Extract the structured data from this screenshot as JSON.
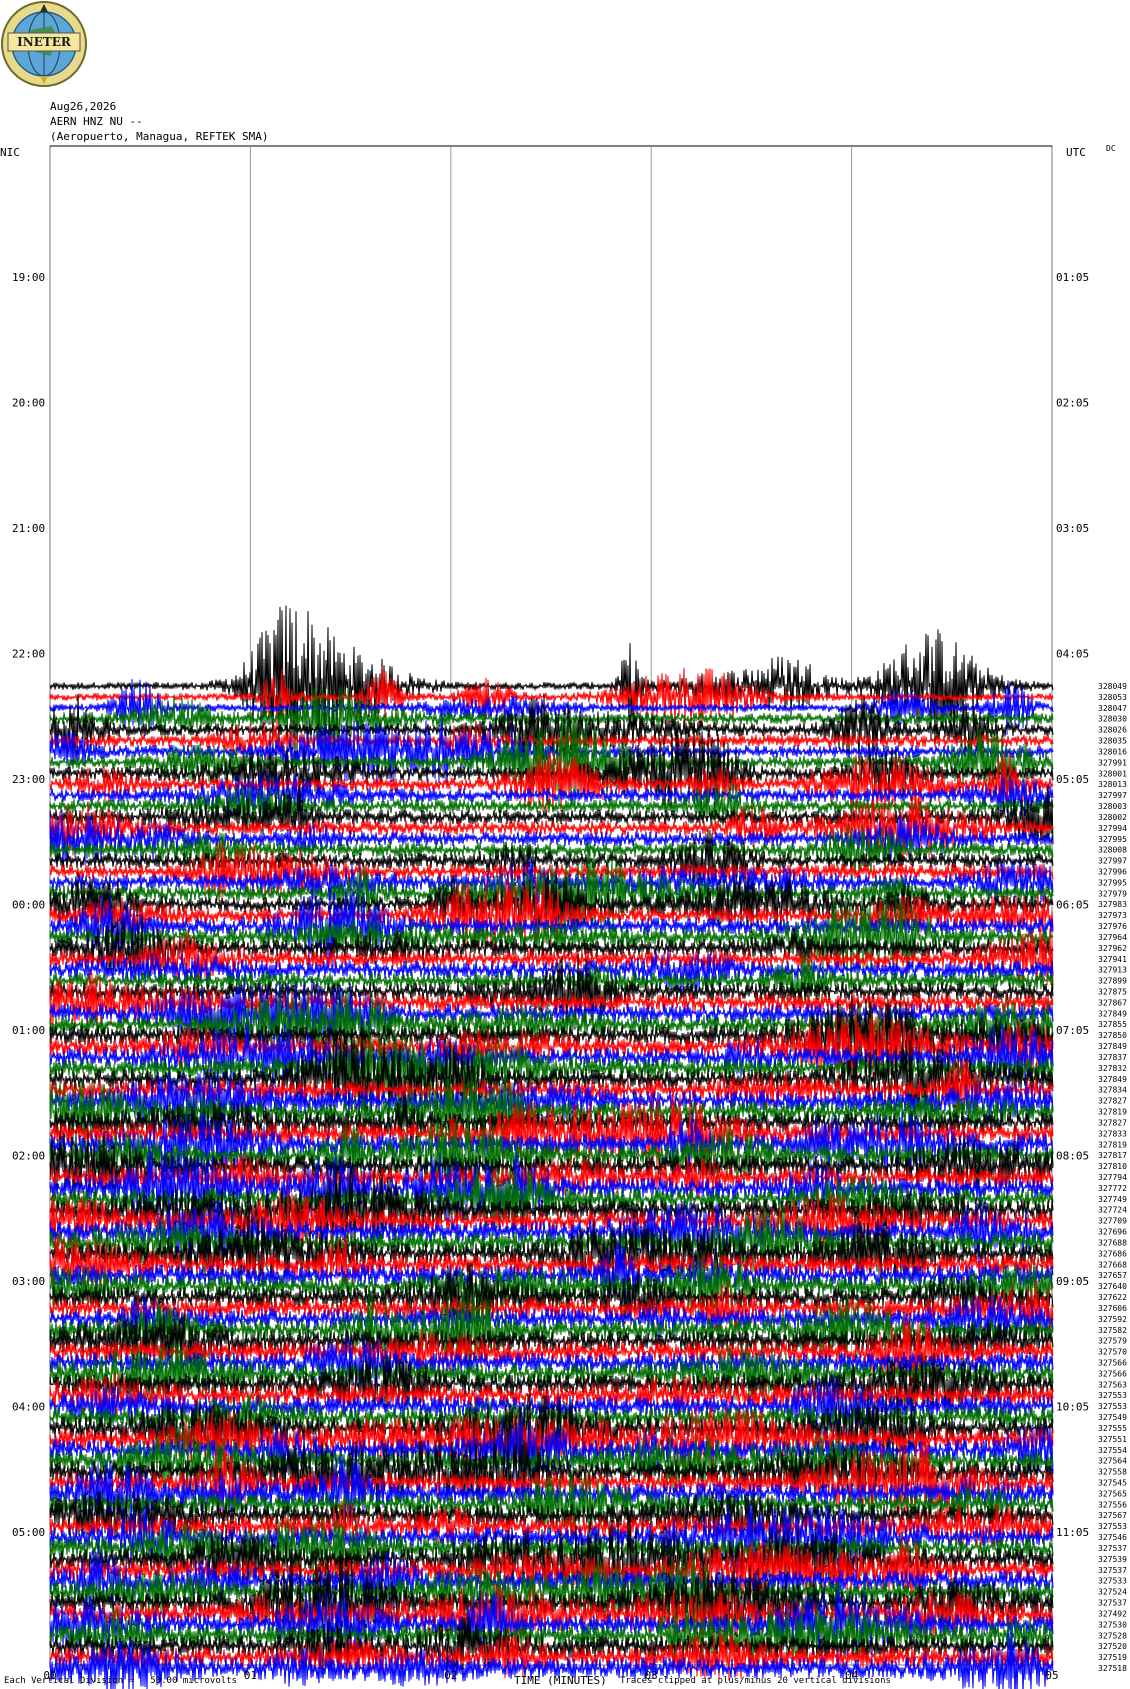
{
  "logo": {
    "text": "INETER"
  },
  "header": {
    "date": "Aug26,2026",
    "station": "AERN HNZ NU --",
    "location": "(Aeropuerto, Managua, REFTEK SMA)"
  },
  "axis": {
    "left_zone": "NIC",
    "right_zone": "UTC",
    "dc_label": "DC",
    "xlabel": "TIME (MINUTES)",
    "x_ticks": [
      "00",
      "01",
      "02",
      "03",
      "04",
      "05"
    ]
  },
  "footer": {
    "scale_note": "Each Vertical Division =   50.00 microvolts",
    "clip_note": "Traces clipped at plus/minus 20 vertical divisions"
  },
  "colors": {
    "trace_cycle": [
      "#000000",
      "#ff0000",
      "#0000ff",
      "#007000"
    ],
    "grid": "#999999"
  },
  "chart_data": {
    "type": "line",
    "xlabel": "TIME (MINUTES)",
    "xlim": [
      0,
      5
    ],
    "left_time_labels": [
      "19:00",
      "20:00",
      "21:00",
      "22:00",
      "23:00",
      "00:00",
      "01:00",
      "02:00",
      "03:00",
      "04:00",
      "05:00"
    ],
    "right_time_labels": [
      "01:05",
      "02:05",
      "03:05",
      "04:05",
      "05:05",
      "06:05",
      "07:05",
      "08:05",
      "09:05",
      "10:05",
      "11:05"
    ],
    "trace_dc_offsets": [
      328049,
      328053,
      328047,
      328030,
      328026,
      328035,
      328016,
      327991,
      328001,
      328013,
      327997,
      328003,
      328002,
      327994,
      327995,
      328008,
      327997,
      327996,
      327995,
      327979,
      327983,
      327973,
      327976,
      327964,
      327962,
      327941,
      327913,
      327899,
      327875,
      327867,
      327849,
      327855,
      327850,
      327849,
      327837,
      327832,
      327849,
      327834,
      327827,
      327819,
      327827,
      327833,
      327819,
      327817,
      327810,
      327794,
      327772,
      327749,
      327724,
      327709,
      327696,
      327688,
      327686,
      327668,
      327657,
      327640,
      327622,
      327606,
      327592,
      327582,
      327579,
      327570,
      327566,
      327566,
      327563,
      327553,
      327553,
      327549,
      327555,
      327551,
      327554,
      327564,
      327558,
      327545,
      327565,
      327556,
      327567,
      327553,
      327546,
      327537,
      327539,
      327537,
      327533,
      327524,
      327537,
      327492,
      327530,
      327528,
      327520,
      327519,
      327518
    ]
  }
}
